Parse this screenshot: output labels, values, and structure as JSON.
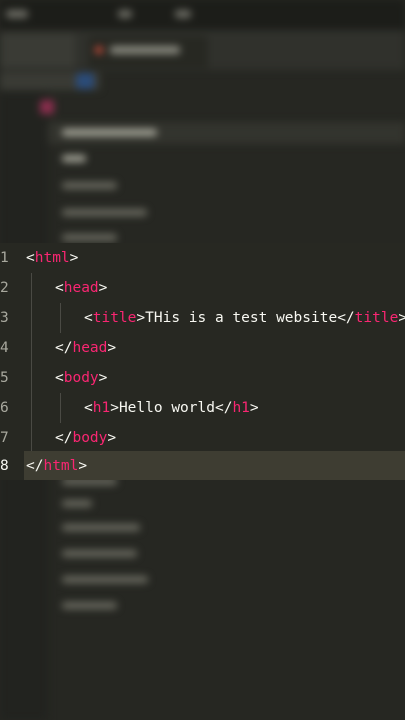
{
  "editor": {
    "lines": [
      {
        "num": "1",
        "open": "<",
        "tag": "html",
        "close": ">",
        "text": "",
        "open2": "",
        "tag2": "",
        "close2": ""
      },
      {
        "num": "2",
        "open": "<",
        "tag": "head",
        "close": ">",
        "text": "",
        "open2": "",
        "tag2": "",
        "close2": ""
      },
      {
        "num": "3",
        "open": "<",
        "tag": "title",
        "close": ">",
        "text": "THis is a test website",
        "open2": "</",
        "tag2": "title",
        "close2": ">"
      },
      {
        "num": "4",
        "open": "</",
        "tag": "head",
        "close": ">",
        "text": "",
        "open2": "",
        "tag2": "",
        "close2": ""
      },
      {
        "num": "5",
        "open": "<",
        "tag": "body",
        "close": ">",
        "text": "",
        "open2": "",
        "tag2": "",
        "close2": ""
      },
      {
        "num": "6",
        "open": "<",
        "tag": "h1",
        "close": ">",
        "text": "Hello world",
        "open2": "</",
        "tag2": "h1",
        "close2": ">"
      },
      {
        "num": "7",
        "open": "</",
        "tag": "body",
        "close": ">",
        "text": "",
        "open2": "",
        "tag2": "",
        "close2": ""
      },
      {
        "num": "8",
        "open": "</",
        "tag": "html",
        "close": ">",
        "text": "",
        "open2": "",
        "tag2": "",
        "close2": ""
      }
    ]
  },
  "colors": {
    "background": "#272822",
    "tag": "#f92672",
    "text": "#f8f8f2",
    "line_number": "#a8a89e",
    "current_line": "#3e3d32"
  }
}
